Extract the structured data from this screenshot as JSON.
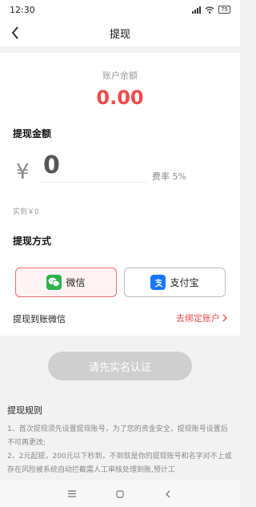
{
  "status_bar": {
    "time": "12:30",
    "battery": "75"
  },
  "nav": {
    "title": "提现"
  },
  "balance": {
    "label": "账户余额",
    "value": "0.00"
  },
  "amount_section": {
    "title": "提现金额",
    "currency_symbol": "¥",
    "amount_placeholder": "0",
    "fee_text": "费率 5%",
    "received_text": "实到￥0"
  },
  "method_section": {
    "title": "提现方式",
    "options": [
      {
        "label": "微信",
        "selected": true,
        "icon": "wechat-icon",
        "color": "#2bb24c"
      },
      {
        "label": "支付宝",
        "selected": false,
        "icon": "alipay-icon",
        "color": "#1677ff"
      }
    ],
    "destination_label": "提现到账微信",
    "bind_link": "去绑定账户"
  },
  "submit_label": "请先实名认证",
  "rules": {
    "title": "提现规则",
    "text": "1、首次提现须先设置提现账号，为了您的资金安全，提现账号设置后不可再更改;\n2、2元起提，200元以下秒到，不到就是你的提现账号和名字对不上或存在风险被系统自动拦截需人工审核处理到账,预计工"
  },
  "colors": {
    "accent": "#ef4a4a",
    "disabled_button": "#cfcfcf"
  }
}
